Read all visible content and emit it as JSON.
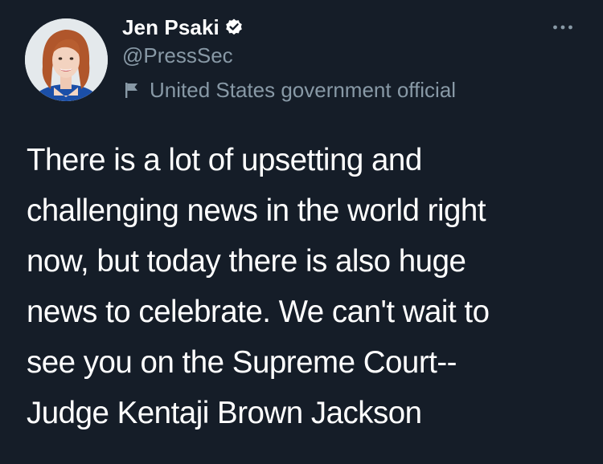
{
  "tweet": {
    "author": {
      "display_name": "Jen Psaki",
      "handle": "@PressSec",
      "label": "United States government official",
      "verified": true
    },
    "text": "There is a lot of upsetting and\nchallenging news in the world right\nnow, but today there is also huge\nnews to celebrate.  We can't wait to\nsee you on the Supreme Court--\nJudge Kentaji Brown Jackson"
  },
  "icons": {
    "avatar": "profile-photo",
    "verified": "verified-badge-icon",
    "label": "government-flag-icon",
    "more": "more-options-icon"
  },
  "colors": {
    "background": "#151d28",
    "primary_text": "#ffffff",
    "secondary_text": "#8899a6",
    "verified_badge": "#ffffff"
  }
}
